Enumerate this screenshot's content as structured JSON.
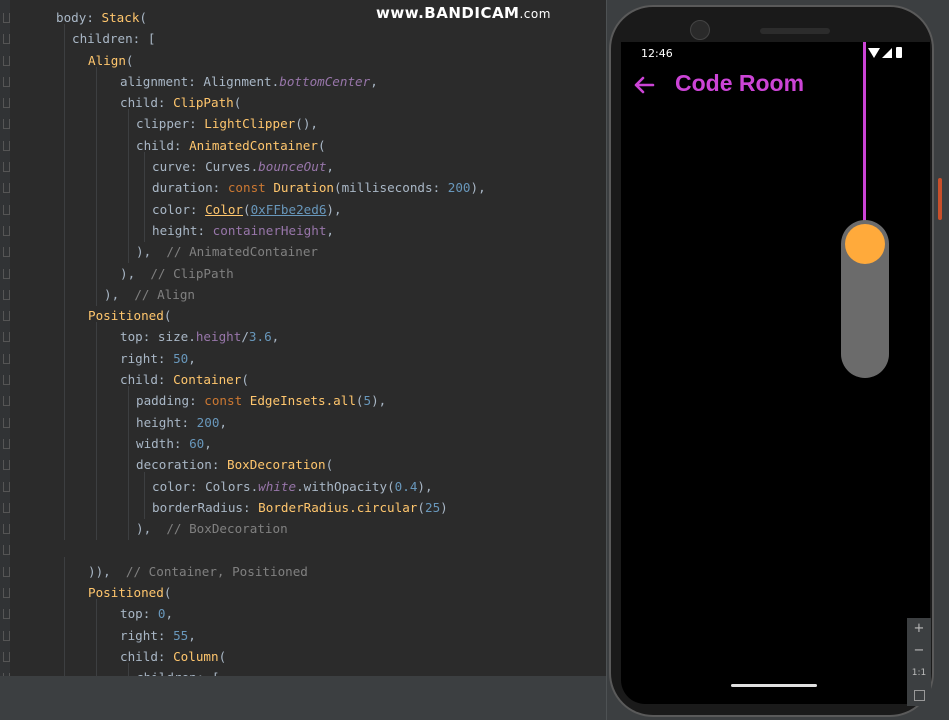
{
  "watermark": {
    "main": "www.BANDICAM",
    "suffix": ".com"
  },
  "code": [
    {
      "indent": 56,
      "tokens": [
        [
          "t",
          "body: "
        ],
        [
          "cls",
          "Stack"
        ],
        [
          "t",
          "("
        ]
      ]
    },
    {
      "indent": 72,
      "tokens": [
        [
          "t",
          "children: ["
        ]
      ]
    },
    {
      "indent": 88,
      "tokens": [
        [
          "cls",
          "Align"
        ],
        [
          "t",
          "("
        ]
      ]
    },
    {
      "indent": 120,
      "tokens": [
        [
          "t",
          "alignment: Alignment."
        ],
        [
          "prop",
          "bottomCenter"
        ],
        [
          "t",
          ","
        ]
      ]
    },
    {
      "indent": 120,
      "tokens": [
        [
          "t",
          "child: "
        ],
        [
          "cls",
          "ClipPath"
        ],
        [
          "t",
          "("
        ]
      ]
    },
    {
      "indent": 136,
      "tokens": [
        [
          "t",
          "clipper: "
        ],
        [
          "cls",
          "LightClipper"
        ],
        [
          "t",
          "(),"
        ]
      ]
    },
    {
      "indent": 136,
      "tokens": [
        [
          "t",
          "child: "
        ],
        [
          "cls",
          "AnimatedContainer"
        ],
        [
          "t",
          "("
        ]
      ]
    },
    {
      "indent": 152,
      "tokens": [
        [
          "t",
          "curve: Curves."
        ],
        [
          "prop",
          "bounceOut"
        ],
        [
          "t",
          ","
        ]
      ]
    },
    {
      "indent": 152,
      "tokens": [
        [
          "t",
          "duration: "
        ],
        [
          "kw",
          "const "
        ],
        [
          "cls",
          "Duration"
        ],
        [
          "t",
          "(milliseconds: "
        ],
        [
          "num",
          "200"
        ],
        [
          "t",
          "),"
        ]
      ]
    },
    {
      "indent": 152,
      "tokens": [
        [
          "t",
          "color: "
        ],
        [
          "lnk",
          "Color"
        ],
        [
          "t",
          "("
        ],
        [
          "lnk2",
          "0xFFbe2ed6"
        ],
        [
          "t",
          "),"
        ]
      ]
    },
    {
      "indent": 152,
      "tokens": [
        [
          "t",
          "height: "
        ],
        [
          "field",
          "containerHeight"
        ],
        [
          "t",
          ","
        ]
      ]
    },
    {
      "indent": 136,
      "tokens": [
        [
          "t",
          "),  "
        ],
        [
          "com",
          "// AnimatedContainer"
        ]
      ]
    },
    {
      "indent": 120,
      "tokens": [
        [
          "t",
          "),  "
        ],
        [
          "com",
          "// ClipPath"
        ]
      ]
    },
    {
      "indent": 104,
      "tokens": [
        [
          "t",
          "),  "
        ],
        [
          "com",
          "// Align"
        ]
      ]
    },
    {
      "indent": 88,
      "tokens": [
        [
          "cls",
          "Positioned"
        ],
        [
          "t",
          "("
        ]
      ]
    },
    {
      "indent": 120,
      "tokens": [
        [
          "t",
          "top: size."
        ],
        [
          "field",
          "height"
        ],
        [
          "t",
          "/"
        ],
        [
          "num",
          "3.6"
        ],
        [
          "t",
          ","
        ]
      ]
    },
    {
      "indent": 120,
      "tokens": [
        [
          "t",
          "right: "
        ],
        [
          "num",
          "50"
        ],
        [
          "t",
          ","
        ]
      ]
    },
    {
      "indent": 120,
      "tokens": [
        [
          "t",
          "child: "
        ],
        [
          "cls",
          "Container"
        ],
        [
          "t",
          "("
        ]
      ]
    },
    {
      "indent": 136,
      "tokens": [
        [
          "t",
          "padding: "
        ],
        [
          "kw",
          "const "
        ],
        [
          "cls",
          "EdgeInsets.all"
        ],
        [
          "t",
          "("
        ],
        [
          "num",
          "5"
        ],
        [
          "t",
          "),"
        ]
      ]
    },
    {
      "indent": 136,
      "tokens": [
        [
          "t",
          "height: "
        ],
        [
          "num",
          "200"
        ],
        [
          "t",
          ","
        ]
      ]
    },
    {
      "indent": 136,
      "tokens": [
        [
          "t",
          "width: "
        ],
        [
          "num",
          "60"
        ],
        [
          "t",
          ","
        ]
      ]
    },
    {
      "indent": 136,
      "tokens": [
        [
          "t",
          "decoration: "
        ],
        [
          "cls",
          "BoxDecoration"
        ],
        [
          "t",
          "("
        ]
      ]
    },
    {
      "indent": 152,
      "tokens": [
        [
          "t",
          "color: Colors."
        ],
        [
          "prop",
          "white"
        ],
        [
          "t",
          ".withOpacity("
        ],
        [
          "num",
          "0.4"
        ],
        [
          "t",
          "),"
        ]
      ]
    },
    {
      "indent": 152,
      "tokens": [
        [
          "t",
          "borderRadius: "
        ],
        [
          "cls",
          "BorderRadius.circular"
        ],
        [
          "t",
          "("
        ],
        [
          "num",
          "25"
        ],
        [
          "t",
          ")"
        ]
      ]
    },
    {
      "indent": 136,
      "tokens": [
        [
          "t",
          "),  "
        ],
        [
          "com",
          "// BoxDecoration"
        ]
      ]
    },
    {
      "indent": 0,
      "tokens": []
    },
    {
      "indent": 88,
      "tokens": [
        [
          "t",
          ")),  "
        ],
        [
          "com",
          "// Container, Positioned"
        ]
      ]
    },
    {
      "indent": 88,
      "tokens": [
        [
          "cls",
          "Positioned"
        ],
        [
          "t",
          "("
        ]
      ]
    },
    {
      "indent": 120,
      "tokens": [
        [
          "t",
          "top: "
        ],
        [
          "num",
          "0"
        ],
        [
          "t",
          ","
        ]
      ]
    },
    {
      "indent": 120,
      "tokens": [
        [
          "t",
          "right: "
        ],
        [
          "num",
          "55"
        ],
        [
          "t",
          ","
        ]
      ]
    },
    {
      "indent": 120,
      "tokens": [
        [
          "t",
          "child: "
        ],
        [
          "cls",
          "Column"
        ],
        [
          "t",
          "("
        ]
      ]
    },
    {
      "indent": 136,
      "tokens": [
        [
          "t",
          "children: ["
        ]
      ]
    }
  ],
  "phone": {
    "status_time": "12:46",
    "app_title": "Code Room",
    "accent": "#cc44d6",
    "knob_color": "#ffaa3b"
  },
  "slider": {
    "value": 0.0
  },
  "zoom": {
    "plus": "+",
    "minus": "−",
    "ratio": "1:1"
  }
}
